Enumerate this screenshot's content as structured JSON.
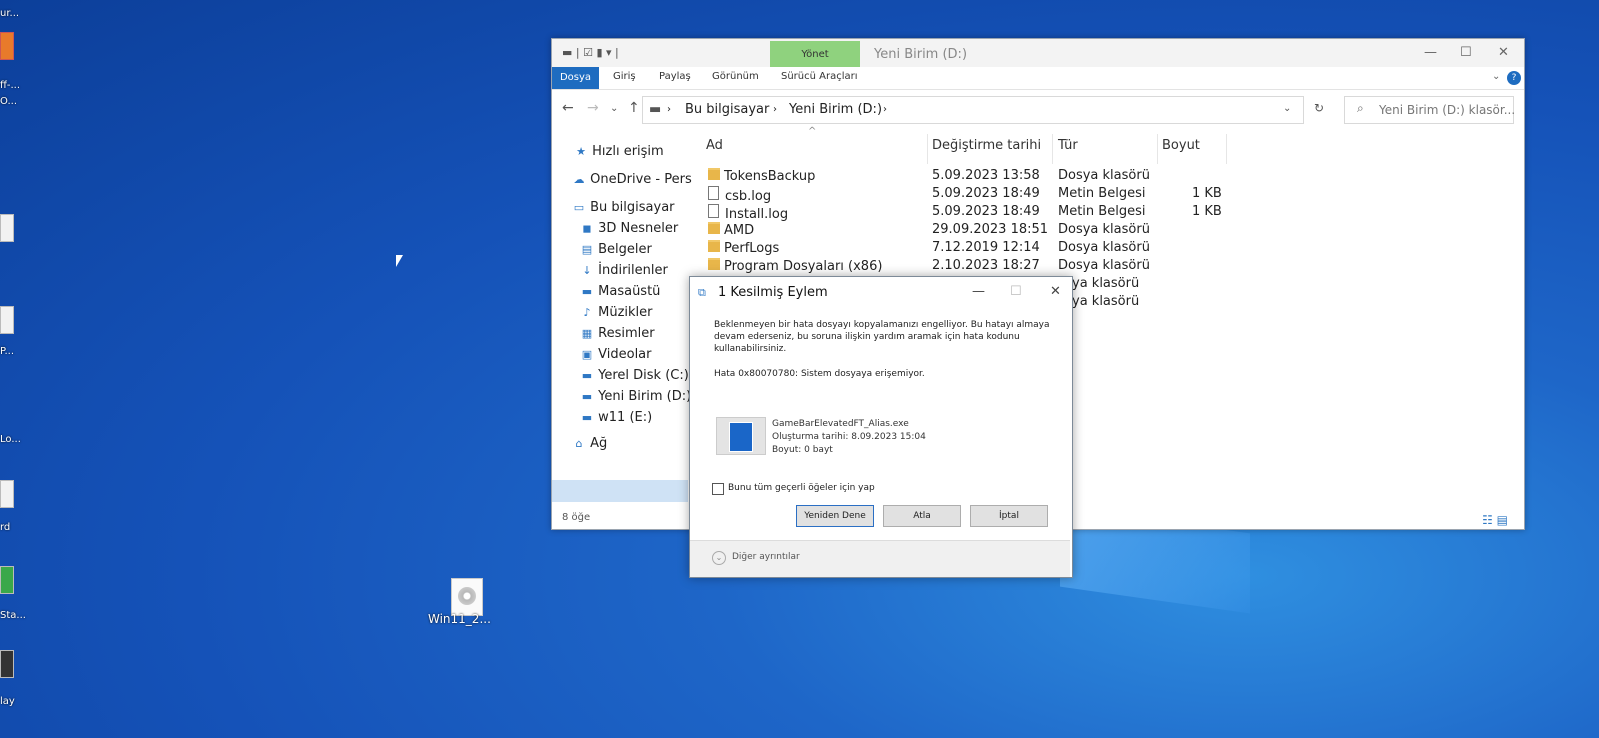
{
  "desktop": {
    "left_labels": [
      "ur...",
      "ff-...",
      "O...",
      "P...",
      "Lo...",
      "rd",
      "Sta...",
      "lay"
    ],
    "iso_label": "Win11_2..."
  },
  "explorer": {
    "title": "Yeni Birim (D:)",
    "manage_tab": "Yönet",
    "ribbon_tabs": [
      "Dosya",
      "Giriş",
      "Paylaş",
      "Görünüm",
      "Sürücü Araçları"
    ],
    "breadcrumb": [
      "Bu bilgisayar",
      "Yeni Birim (D:)"
    ],
    "search_placeholder": "Yeni Birim (D:) klasör...",
    "nav": [
      {
        "label": "Hızlı erişim",
        "icon": "star-icon"
      },
      {
        "label": "OneDrive - Pers",
        "icon": "cloud-icon"
      },
      {
        "label": "Bu bilgisayar",
        "icon": "computer-icon"
      },
      {
        "label": "3D Nesneler",
        "icon": "cube-icon"
      },
      {
        "label": "Belgeler",
        "icon": "document-icon"
      },
      {
        "label": "İndirilenler",
        "icon": "download-icon"
      },
      {
        "label": "Masaüstü",
        "icon": "desktop-icon"
      },
      {
        "label": "Müzikler",
        "icon": "music-icon"
      },
      {
        "label": "Resimler",
        "icon": "image-icon"
      },
      {
        "label": "Videolar",
        "icon": "video-icon"
      },
      {
        "label": "Yerel Disk (C:)",
        "icon": "drive-icon"
      },
      {
        "label": "Yeni Birim (D:)",
        "icon": "drive-icon"
      },
      {
        "label": "w11 (E:)",
        "icon": "drive-icon"
      },
      {
        "label": "Ağ",
        "icon": "network-icon"
      }
    ],
    "columns": [
      "Ad",
      "Değiştirme tarihi",
      "Tür",
      "Boyut"
    ],
    "files": [
      {
        "name": "TokensBackup",
        "date": "5.09.2023 13:58",
        "type": "Dosya klasörü",
        "size": "",
        "kind": "folder"
      },
      {
        "name": "csb.log",
        "date": "5.09.2023 18:49",
        "type": "Metin Belgesi",
        "size": "1 KB",
        "kind": "file"
      },
      {
        "name": "Install.log",
        "date": "5.09.2023 18:49",
        "type": "Metin Belgesi",
        "size": "1 KB",
        "kind": "file"
      },
      {
        "name": "AMD",
        "date": "29.09.2023 18:51",
        "type": "Dosya klasörü",
        "size": "",
        "kind": "folder"
      },
      {
        "name": "PerfLogs",
        "date": "7.12.2019 12:14",
        "type": "Dosya klasörü",
        "size": "",
        "kind": "folder"
      },
      {
        "name": "Program Dosyaları (x86)",
        "date": "2.10.2023 18:27",
        "type": "Dosya klasörü",
        "size": "",
        "kind": "folder"
      },
      {
        "name": "",
        "date": "",
        "type": "ya klasörü",
        "size": "",
        "kind": "hidden"
      },
      {
        "name": "",
        "date": "",
        "type": "ya klasörü",
        "size": "",
        "kind": "hidden"
      }
    ],
    "status": "8 öğe"
  },
  "dialog": {
    "title": "1 Kesilmiş Eylem",
    "message": "Beklenmeyen bir hata dosyayı kopyalamanızı engelliyor. Bu hatayı almaya devam ederseniz, bu soruna ilişkin yardım aramak için hata kodunu kullanabilirsiniz.",
    "error": "Hata 0x80070780: Sistem dosyaya erişemiyor.",
    "file_name": "GameBarElevatedFT_Alias.exe",
    "file_created": "Oluşturma tarihi: 8.09.2023 15:04",
    "file_size": "Boyut: 0 bayt",
    "checkbox_label": "Bunu tüm geçerli öğeler için yap",
    "btn_retry": "Yeniden Dene",
    "btn_skip": "Atla",
    "btn_cancel": "İptal",
    "more_details": "Diğer ayrıntılar"
  }
}
